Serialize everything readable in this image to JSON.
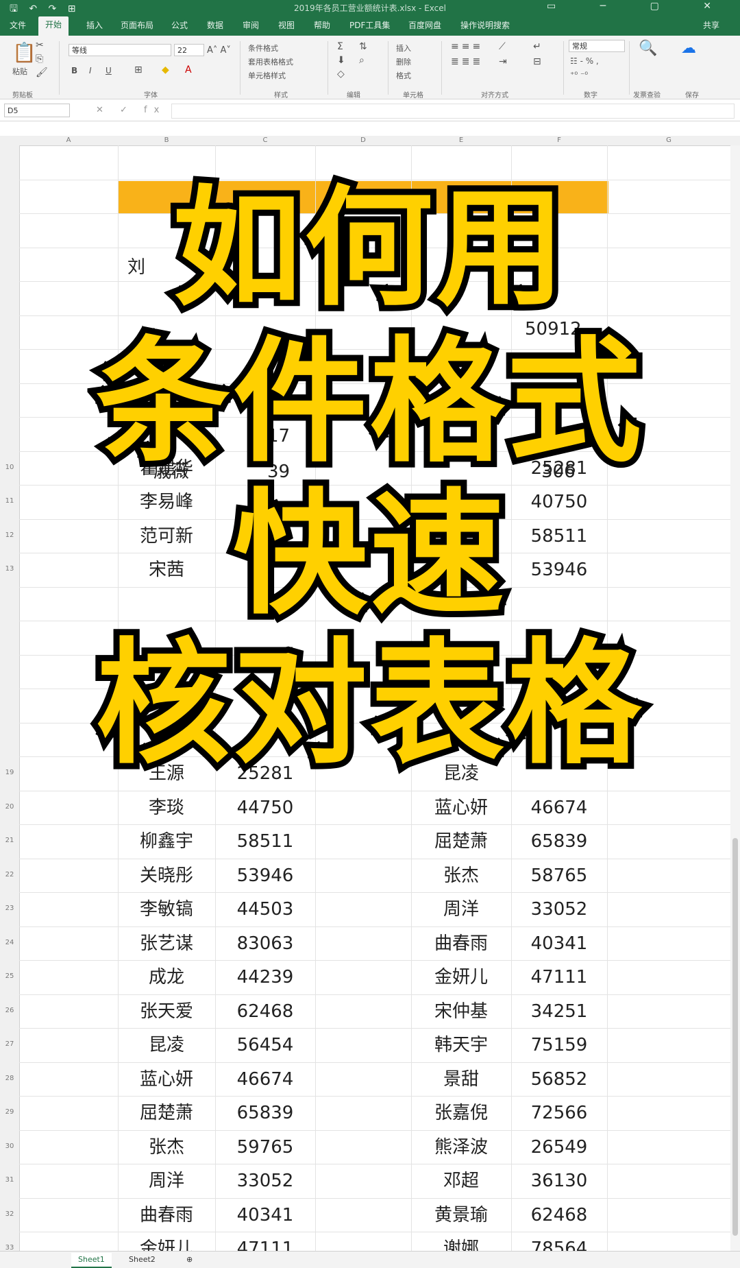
{
  "titlebar": {
    "quick_access": "🖫 ↶ ↷ ⊞",
    "title": "2019年各员工营业额统计表.xlsx - Excel",
    "window_controls": "▭ ─ ▢ ✕"
  },
  "tabs": [
    "文件",
    "开始",
    "插入",
    "页面布局",
    "公式",
    "数据",
    "审阅",
    "视图",
    "帮助",
    "PDF工具集",
    "百度网盘",
    "操作说明搜索",
    "共享"
  ],
  "ribbon": {
    "paste": "粘贴",
    "font_name": "等线",
    "font_size": "22",
    "bold": "B",
    "italic": "I",
    "underline": "U",
    "cond_format": "条件格式",
    "table_format": "套用表格格式",
    "cell_style": "单元格样式",
    "insert": "插入",
    "delete": "删除",
    "format": "格式",
    "number_format": "常规",
    "groups": [
      "剪贴板",
      "字体",
      "样式",
      "编辑",
      "单元格",
      "对齐方式",
      "数字",
      "发票查验",
      "保存"
    ]
  },
  "formula_bar": {
    "name_box": "D5",
    "fx": "✕ ✓ fx"
  },
  "columns": [
    "A",
    "B",
    "C",
    "D",
    "E",
    "F",
    "G"
  ],
  "overlay_title": [
    "如何用",
    "条件格式",
    "快速",
    "核对表格"
  ],
  "visible_rows": [
    {
      "row": "10",
      "b": "霍建华",
      "f": "25281"
    },
    {
      "row": "11",
      "b": "李易峰",
      "f": "40750"
    },
    {
      "row": "12",
      "b": "范可新",
      "f": "58511"
    },
    {
      "row": "13",
      "b": "宋茜",
      "f": "53946"
    },
    {
      "row": "19",
      "b": "王源",
      "c": "25281",
      "e": "昆凌"
    },
    {
      "row": "20",
      "b": "李琰",
      "c": "44750",
      "e": "蓝心妍",
      "f": "46674"
    },
    {
      "row": "21",
      "b": "柳鑫宇",
      "c": "58511",
      "e": "屈楚萧",
      "f": "65839"
    },
    {
      "row": "22",
      "b": "关晓彤",
      "c": "53946",
      "e": "张杰",
      "f": "58765"
    },
    {
      "row": "23",
      "b": "李敏镐",
      "c": "44503",
      "e": "周洋",
      "f": "33052"
    },
    {
      "row": "24",
      "b": "张艺谋",
      "c": "83063",
      "e": "曲春雨",
      "f": "40341"
    },
    {
      "row": "25",
      "b": "成龙",
      "c": "44239",
      "e": "金妍儿",
      "f": "47111"
    },
    {
      "row": "26",
      "b": "张天爱",
      "c": "62468",
      "e": "宋仲基",
      "f": "34251"
    },
    {
      "row": "27",
      "b": "昆凌",
      "c": "56454",
      "e": "韩天宇",
      "f": "75159"
    },
    {
      "row": "28",
      "b": "蓝心妍",
      "c": "46674",
      "e": "景甜",
      "f": "56852"
    },
    {
      "row": "29",
      "b": "屈楚萧",
      "c": "65839",
      "e": "张嘉倪",
      "f": "72566"
    },
    {
      "row": "30",
      "b": "张杰",
      "c": "59765",
      "e": "熊泽波",
      "f": "26549"
    },
    {
      "row": "31",
      "b": "周洋",
      "c": "33052",
      "e": "邓超",
      "f": "36130"
    },
    {
      "row": "32",
      "b": "曲春雨",
      "c": "40341",
      "e": "黄景瑜",
      "f": "62468"
    },
    {
      "row": "33",
      "b": "金妍儿",
      "c": "47111",
      "e": "谢娜",
      "f": "78564"
    }
  ],
  "peek": {
    "r4_b": "刘",
    "r5_f": "50912",
    "r6_c": "17",
    "r9_b": "戚薇",
    "r9_c": "39",
    "r9_f": "306"
  },
  "sheets": [
    "Sheet1",
    "Sheet2",
    "⊕"
  ],
  "colors": {
    "excel_green": "#217346",
    "title_yellow": "#ffd000",
    "header_orange": "#f9b219"
  }
}
